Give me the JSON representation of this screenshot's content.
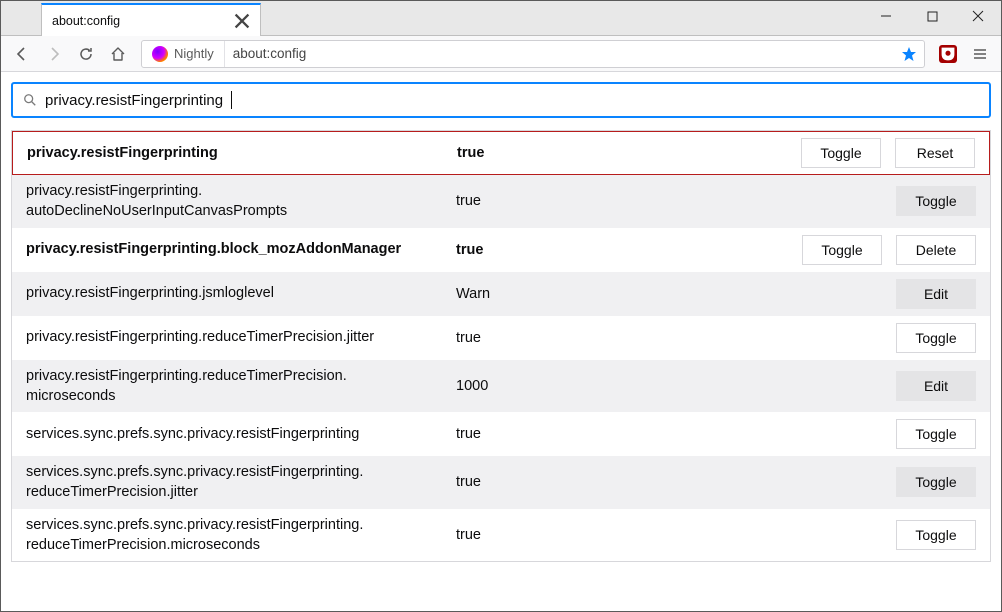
{
  "window": {
    "tab_title": "about:config",
    "identity_label": "Nightly",
    "url": "about:config"
  },
  "search": {
    "value": "privacy.resistFingerprinting"
  },
  "buttons": {
    "toggle": "Toggle",
    "reset": "Reset",
    "delete": "Delete",
    "edit": "Edit"
  },
  "prefs": [
    {
      "name": "privacy.resistFingerprinting",
      "value": "true",
      "bold": true,
      "highlight": true,
      "alt": false,
      "action1": "Toggle",
      "action2": "Reset",
      "ghost1": true,
      "ghost2": true
    },
    {
      "name": "privacy.resistFingerprinting.\nautoDeclineNoUserInputCanvasPrompts",
      "value": "true",
      "bold": false,
      "highlight": false,
      "alt": true,
      "action1": "Toggle",
      "action2": "",
      "ghost1": false,
      "ghost2": false
    },
    {
      "name": "privacy.resistFingerprinting.block_mozAddonManager",
      "value": "true",
      "bold": true,
      "highlight": false,
      "alt": false,
      "action1": "Toggle",
      "action2": "Delete",
      "ghost1": true,
      "ghost2": true
    },
    {
      "name": "privacy.resistFingerprinting.jsmloglevel",
      "value": "Warn",
      "bold": false,
      "highlight": false,
      "alt": true,
      "action1": "Edit",
      "action2": "",
      "ghost1": false,
      "ghost2": false
    },
    {
      "name": "privacy.resistFingerprinting.reduceTimerPrecision.jitter",
      "value": "true",
      "bold": false,
      "highlight": false,
      "alt": false,
      "action1": "Toggle",
      "action2": "",
      "ghost1": true,
      "ghost2": false
    },
    {
      "name": "privacy.resistFingerprinting.reduceTimerPrecision.\nmicroseconds",
      "value": "1000",
      "bold": false,
      "highlight": false,
      "alt": true,
      "action1": "Edit",
      "action2": "",
      "ghost1": false,
      "ghost2": false
    },
    {
      "name": "services.sync.prefs.sync.privacy.resistFingerprinting",
      "value": "true",
      "bold": false,
      "highlight": false,
      "alt": false,
      "action1": "Toggle",
      "action2": "",
      "ghost1": true,
      "ghost2": false
    },
    {
      "name": "services.sync.prefs.sync.privacy.resistFingerprinting.\nreduceTimerPrecision.jitter",
      "value": "true",
      "bold": false,
      "highlight": false,
      "alt": true,
      "action1": "Toggle",
      "action2": "",
      "ghost1": false,
      "ghost2": false
    },
    {
      "name": "services.sync.prefs.sync.privacy.resistFingerprinting.\nreduceTimerPrecision.microseconds",
      "value": "true",
      "bold": false,
      "highlight": false,
      "alt": false,
      "action1": "Toggle",
      "action2": "",
      "ghost1": true,
      "ghost2": false
    }
  ]
}
